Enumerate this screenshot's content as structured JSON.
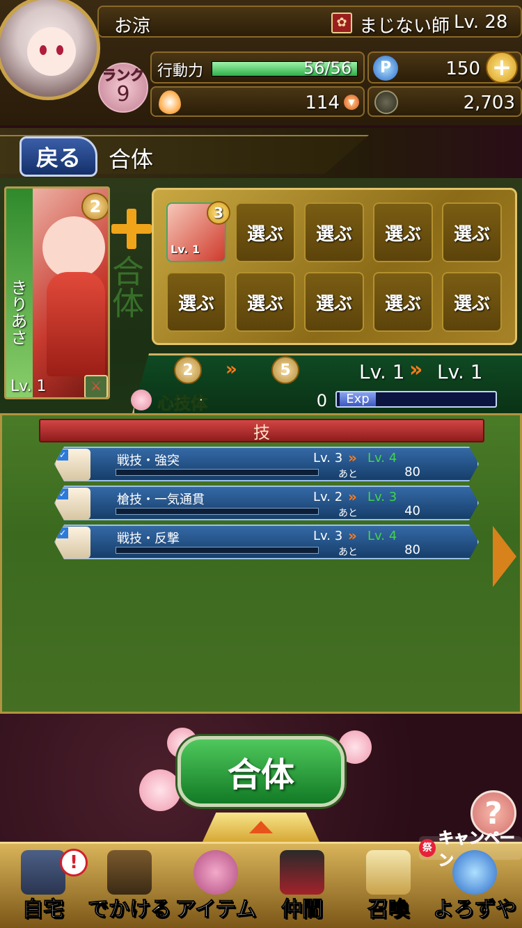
{
  "player": {
    "name": "お涼",
    "job": "まじない師",
    "level": "Lv. 28",
    "rank_label": "ランク",
    "rank": "9"
  },
  "stats": {
    "stamina_label": "行動力",
    "stamina": "56/56",
    "stamina_fraction": 1.0,
    "points": "150",
    "drops": "114",
    "coins": "2,703"
  },
  "nav": {
    "back_label": "戻る",
    "title": "合体"
  },
  "base_card": {
    "name": "きりあさ",
    "level": "Lv. 1",
    "badge": "2"
  },
  "fusion_mark": "合体",
  "material_slots": {
    "first_badge": "3",
    "first_level": "Lv. 1",
    "select_label": "選ぶ",
    "empty_count": 9
  },
  "result": {
    "from_badge": "2",
    "to_badge": "5",
    "lv_from": "Lv. 1",
    "lv_to": "Lv. 1",
    "section_label": "心技体",
    "exp_value": "0",
    "exp_label": "Exp",
    "exp_fraction": 0.0
  },
  "skills_header": "技",
  "skills": [
    {
      "name": "戦技・強突",
      "lv": "Lv. 3",
      "next": "Lv. 4",
      "ato": "あと",
      "remain": "80"
    },
    {
      "name": "槍技・一気通貫",
      "lv": "Lv. 2",
      "next": "Lv. 3",
      "ato": "あと",
      "remain": "40"
    },
    {
      "name": "戦技・反撃",
      "lv": "Lv. 3",
      "next": "Lv. 4",
      "ato": "あと",
      "remain": "80"
    }
  ],
  "action": {
    "fuse_label": "合体",
    "help_label": "?",
    "campaign_label": "キャンペーン"
  },
  "bottom_nav": [
    {
      "label": "自宅",
      "icon": "house-icon"
    },
    {
      "label": "でかける",
      "icon": "gate-icon"
    },
    {
      "label": "アイテム",
      "icon": "pouch-icon"
    },
    {
      "label": "仲間",
      "icon": "companions-icon"
    },
    {
      "label": "召喚",
      "icon": "summon-icon"
    },
    {
      "label": "よろずや",
      "icon": "shop-icon"
    }
  ],
  "colors": {
    "gold": "#c9a842",
    "green_button": "#1c8a2e",
    "skill_blue": "#1f4f85",
    "next_level_green": "#3fd648"
  }
}
